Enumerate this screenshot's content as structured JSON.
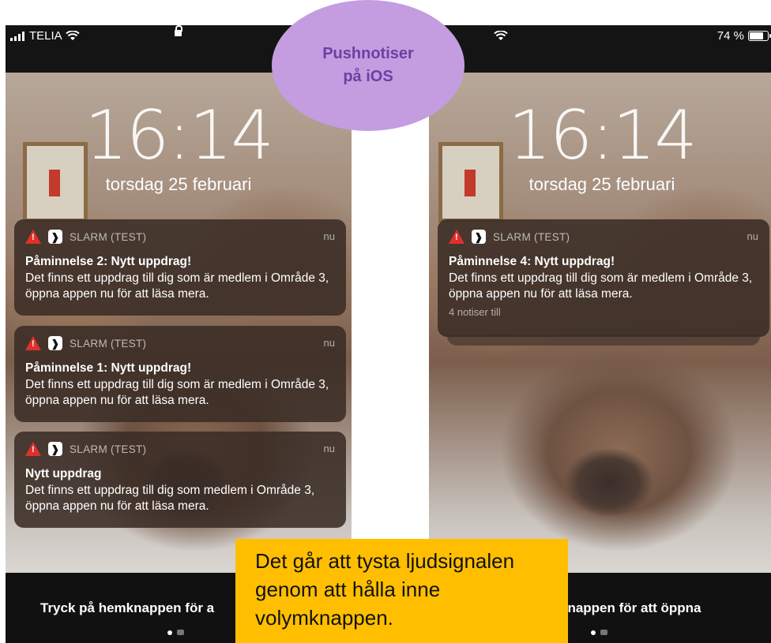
{
  "overlay": {
    "title_line1": "Pushnotiser",
    "title_line2": "på iOS",
    "note": "Det går att tysta ljudsignalen genom att hålla inne volymknappen.",
    "ellipse_color": "#c39de0",
    "note_color": "#ffbf00"
  },
  "left_phone": {
    "status": {
      "carrier": "TELIA"
    },
    "time": "16:14",
    "date": "torsdag 25 februari",
    "notifications": [
      {
        "app": "SLARM (TEST)",
        "time": "nu",
        "title": "Påminnelse 2: Nytt uppdrag!",
        "body": "Det finns ett uppdrag till dig som är medlem i Område 3, öppna appen nu för att läsa mera."
      },
      {
        "app": "SLARM (TEST)",
        "time": "nu",
        "title": "Påminnelse 1: Nytt uppdrag!",
        "body": "Det finns ett uppdrag till dig som är medlem i Område 3, öppna appen nu för att läsa mera."
      },
      {
        "app": "SLARM (TEST)",
        "time": "nu",
        "title": "Nytt uppdrag",
        "body": "Det finns ett uppdrag till dig som medlem i Område 3, öppna appen nu för att läsa mera."
      }
    ],
    "home_hint": "Tryck på hemknappen för a"
  },
  "right_phone": {
    "status": {
      "battery": "74 %"
    },
    "time": "16:14",
    "date": "torsdag 25 februari",
    "notification": {
      "app": "SLARM (TEST)",
      "time": "nu",
      "title": "Påminnelse 4: Nytt uppdrag!",
      "body": "Det finns ett uppdrag till dig som är medlem i Område 3, öppna appen nu för att läsa mera.",
      "more": "4 notiser till"
    },
    "home_hint": "knappen för att öppna"
  },
  "icons": [
    "signal-icon",
    "wifi-icon",
    "lock-icon",
    "battery-icon",
    "warning-icon",
    "slarm-app-icon",
    "camera-icon"
  ]
}
